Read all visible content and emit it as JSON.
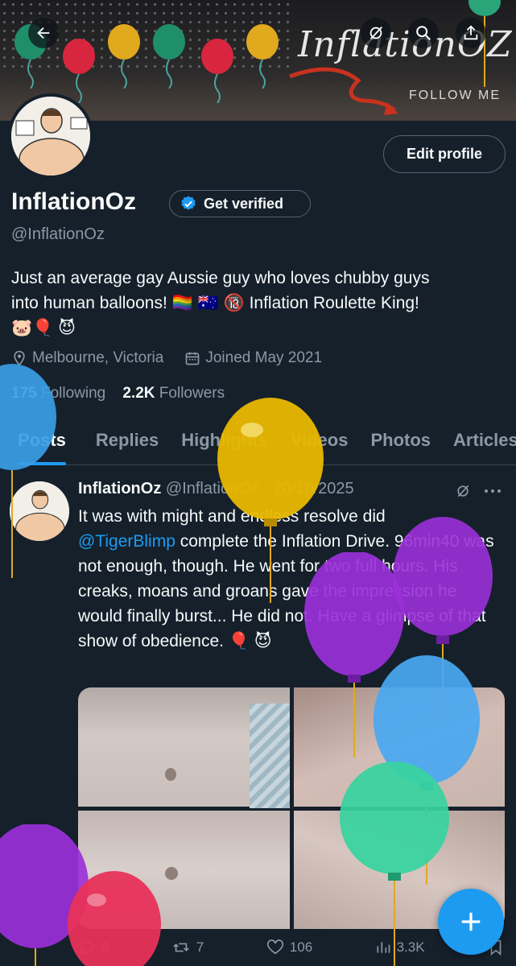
{
  "banner": {
    "title": "InflationOZ",
    "follow_text": "FOLLOW ME"
  },
  "profile": {
    "display_name": "InflationOz",
    "get_verified_label": "Get verified",
    "handle": "@InflationOz",
    "bio_line1": "Just an average gay Aussie guy who loves chubby guys",
    "bio_line2": "into human balloons! 🏳️‍🌈 🇦🇺 🔞 Inflation Roulette King!",
    "bio_line3": "🐷🎈 😈",
    "edit_profile_label": "Edit profile",
    "location": "Melbourne, Victoria",
    "joined": "Joined May 2021",
    "following_count": "175",
    "following_label": "Following",
    "followers_count": "2.2K",
    "followers_label": "Followers"
  },
  "tabs": [
    {
      "label": "Posts"
    },
    {
      "label": "Replies"
    },
    {
      "label": "Highlights"
    },
    {
      "label": "Videos"
    },
    {
      "label": "Photos"
    },
    {
      "label": "Articles"
    }
  ],
  "post": {
    "author": "InflationOz",
    "handle_date": "@InflationOz · 20/10/2025",
    "text_before_mention": "It was with might and endless resolve did",
    "mention": "@TigerBlimp",
    "text_after_mention": " complete the Inflation Drive. 96min40 was not enough, though. He went for two full hours. His creaks, moans and groans gave the impression he would finally burst... He did not. Have a glimpse of that show of obedience. 🎈 😈",
    "replies": "6",
    "reposts": "7",
    "likes": "106",
    "views": "3.3K"
  },
  "icons": {
    "back": "back-arrow-icon",
    "grok": "grok-icon",
    "search": "search-icon",
    "share": "share-icon",
    "verified": "verified-badge-icon",
    "location": "location-pin-icon",
    "calendar": "calendar-icon",
    "more": "more-icon",
    "reply": "reply-icon",
    "repost": "repost-icon",
    "like": "heart-icon",
    "views": "views-icon",
    "bookmark": "bookmark-icon",
    "compose": "plus-icon"
  },
  "colors": {
    "accent": "#1d9bf0",
    "background": "#15202b",
    "muted": "#8b98a5"
  }
}
